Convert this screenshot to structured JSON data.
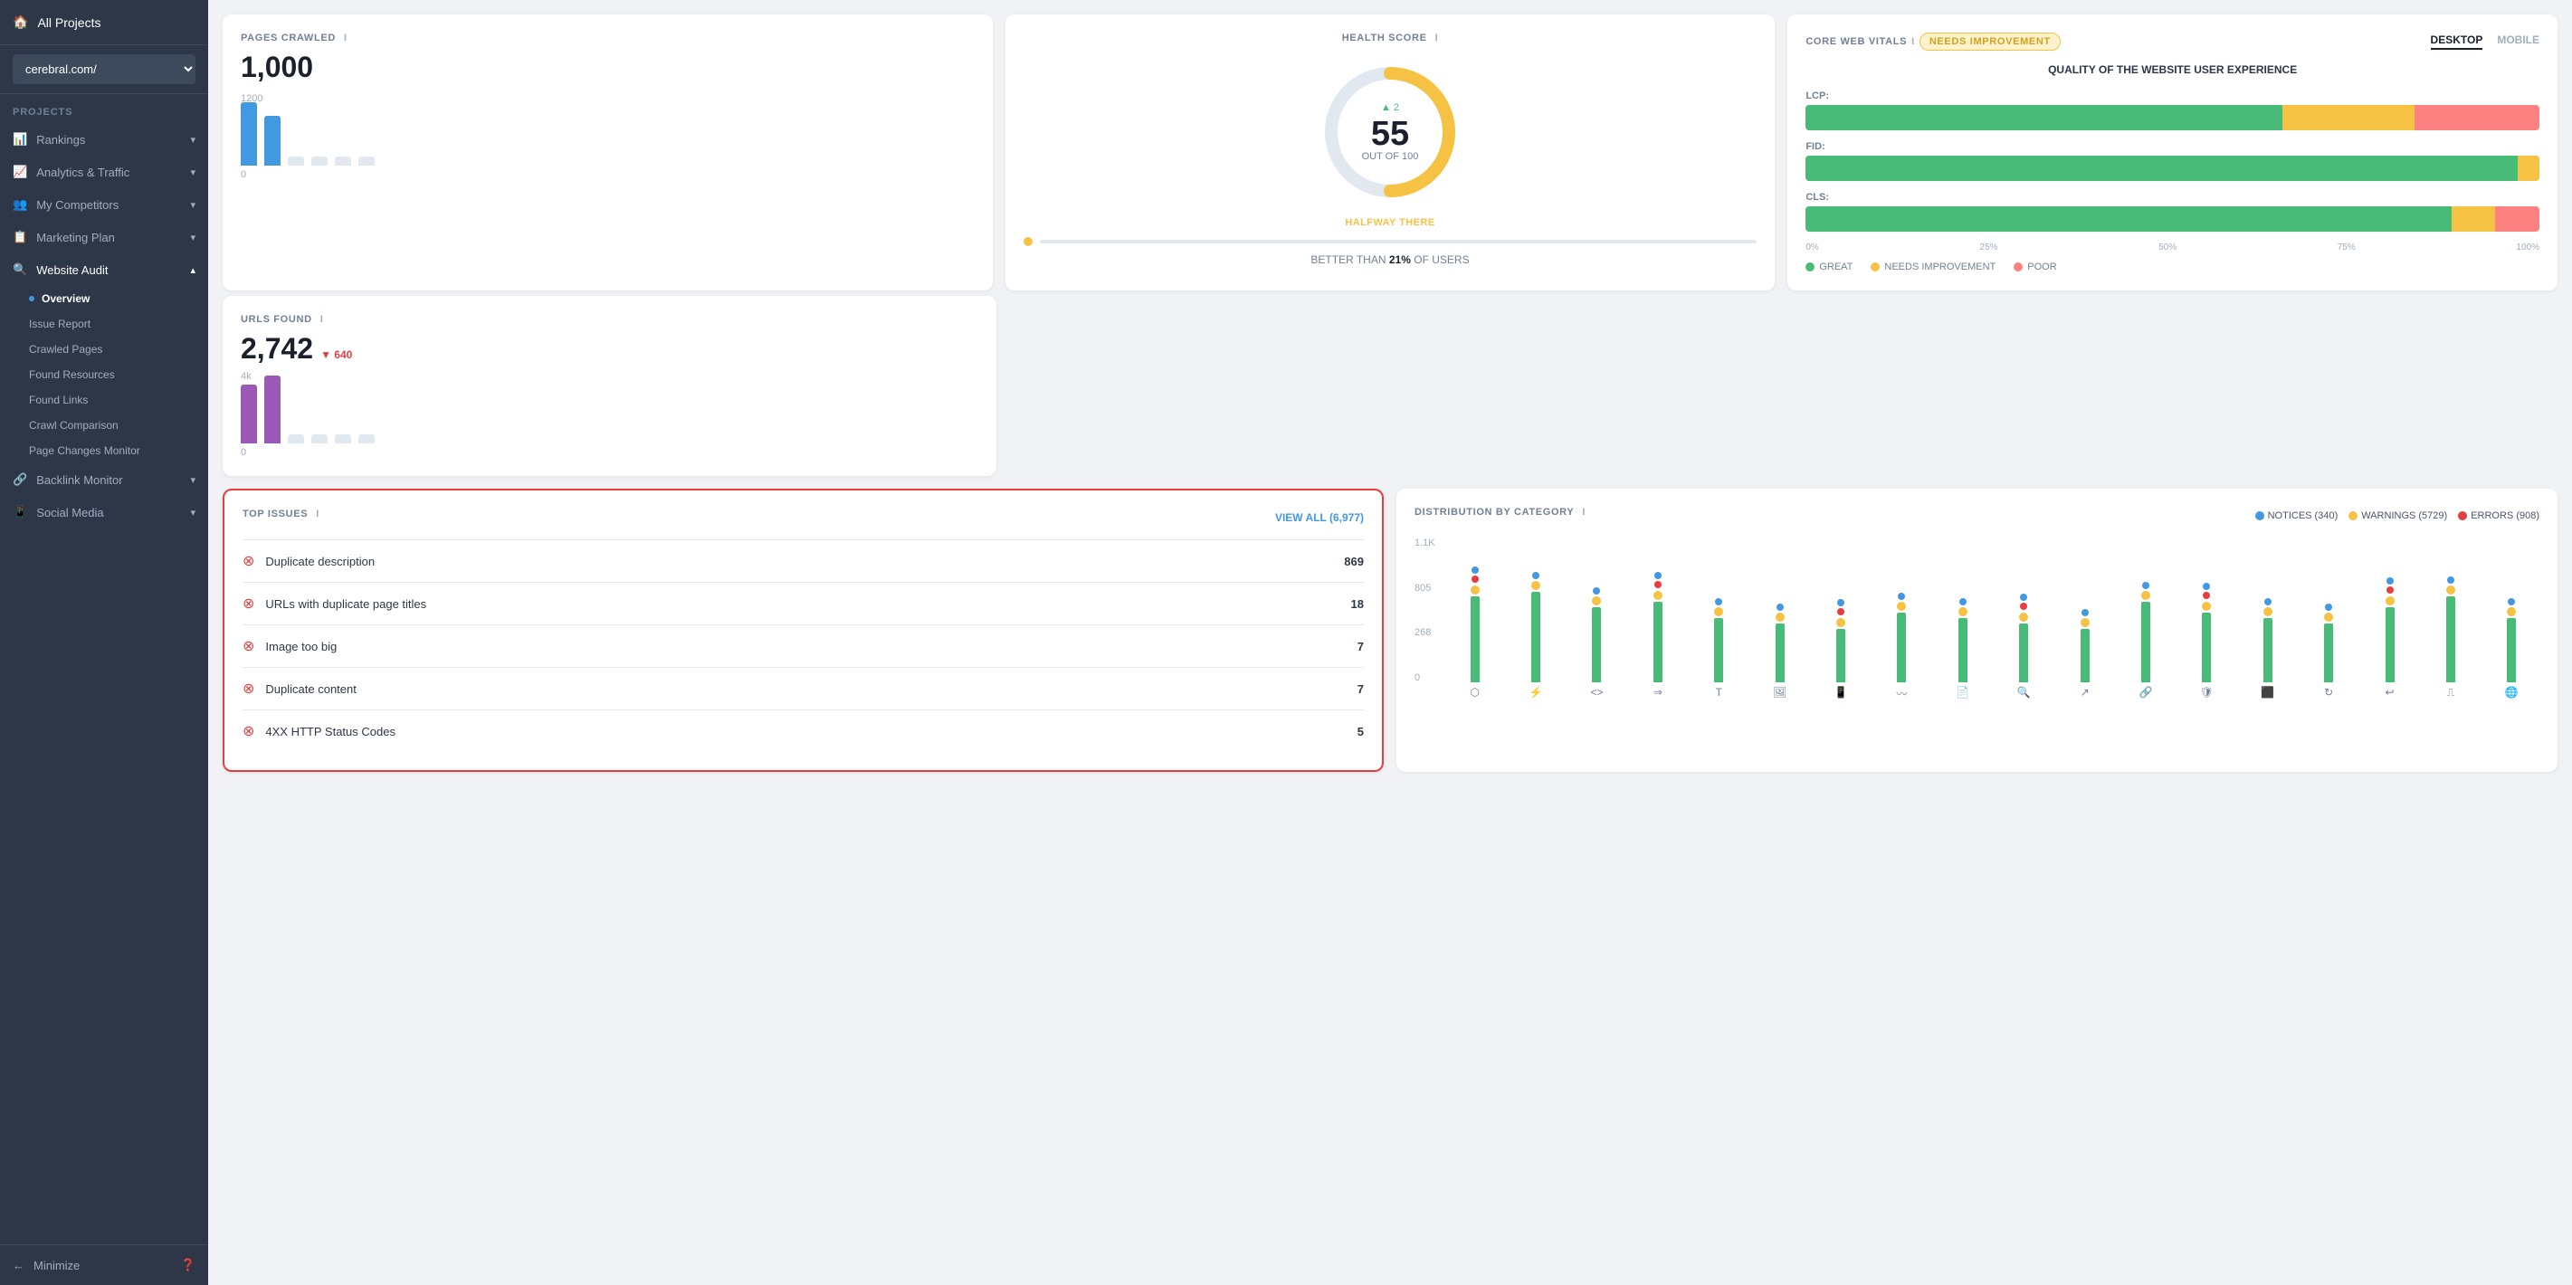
{
  "sidebar": {
    "all_projects_label": "All Projects",
    "project_name": "cerebral.com/",
    "projects_section": "PROJECTS",
    "items": [
      {
        "id": "rankings",
        "label": "Rankings",
        "icon": "📊",
        "has_chevron": true
      },
      {
        "id": "analytics",
        "label": "Analytics & Traffic",
        "icon": "📈",
        "has_chevron": true
      },
      {
        "id": "competitors",
        "label": "My Competitors",
        "icon": "👥",
        "has_chevron": true
      },
      {
        "id": "marketing",
        "label": "Marketing Plan",
        "icon": "📋",
        "has_chevron": true
      },
      {
        "id": "audit",
        "label": "Website Audit",
        "icon": "🔍",
        "has_chevron": true,
        "active": true
      }
    ],
    "audit_sub_items": [
      {
        "id": "overview",
        "label": "Overview",
        "active": true
      },
      {
        "id": "issue-report",
        "label": "Issue Report"
      },
      {
        "id": "crawled-pages",
        "label": "Crawled Pages"
      },
      {
        "id": "found-resources",
        "label": "Found Resources"
      },
      {
        "id": "found-links",
        "label": "Found Links"
      },
      {
        "id": "crawl-comparison",
        "label": "Crawl Comparison"
      },
      {
        "id": "page-changes",
        "label": "Page Changes Monitor"
      }
    ],
    "other_items": [
      {
        "id": "backlink",
        "label": "Backlink Monitor",
        "icon": "🔗",
        "has_chevron": true
      },
      {
        "id": "social",
        "label": "Social Media",
        "icon": "📱",
        "has_chevron": true
      }
    ],
    "minimize_label": "Minimize",
    "help_icon": "?"
  },
  "pages_crawled": {
    "label": "PAGES CRAWLED",
    "info": "i",
    "value": "1,000",
    "chart_max": "1200",
    "chart_min": "0",
    "bars": [
      {
        "height": 70,
        "color": "#4299e1"
      },
      {
        "height": 55,
        "color": "#4299e1"
      },
      {
        "height": 10,
        "color": "#e2e8f0"
      },
      {
        "height": 10,
        "color": "#e2e8f0"
      },
      {
        "height": 10,
        "color": "#e2e8f0"
      },
      {
        "height": 10,
        "color": "#e2e8f0"
      }
    ]
  },
  "urls_found": {
    "label": "URLS FOUND",
    "info": "i",
    "value": "2,742",
    "delta": "▼ 640",
    "chart_max": "4k",
    "chart_min": "0",
    "bars": [
      {
        "height": 65,
        "color": "#9b59b6"
      },
      {
        "height": 75,
        "color": "#9b59b6"
      },
      {
        "height": 10,
        "color": "#e2e8f0"
      },
      {
        "height": 10,
        "color": "#e2e8f0"
      },
      {
        "height": 10,
        "color": "#e2e8f0"
      },
      {
        "height": 10,
        "color": "#e2e8f0"
      }
    ]
  },
  "health_score": {
    "label": "HEALTH SCORE",
    "info": "i",
    "score": "55",
    "out_of": "OUT OF 100",
    "delta": "▲ 2",
    "halfway_label": "HALFWAY THERE",
    "better_than_prefix": "BETTER THAN",
    "better_than_pct": "21%",
    "better_than_suffix": "OF USERS"
  },
  "cwv": {
    "title": "CORE WEB VITALS",
    "info": "i",
    "badge": "Needs improvement",
    "tabs": [
      "DESKTOP",
      "MOBILE"
    ],
    "active_tab": "DESKTOP",
    "subtitle": "QUALITY OF THE WEBSITE USER EXPERIENCE",
    "bars": [
      {
        "label": "LCP:",
        "segments": [
          {
            "pct": 65,
            "color": "#48bb78"
          },
          {
            "pct": 18,
            "color": "#f6c244"
          },
          {
            "pct": 17,
            "color": "#fc8181"
          }
        ]
      },
      {
        "label": "FID:",
        "segments": [
          {
            "pct": 97,
            "color": "#48bb78"
          },
          {
            "pct": 3,
            "color": "#f6c244"
          }
        ]
      },
      {
        "label": "CLS:",
        "segments": [
          {
            "pct": 88,
            "color": "#48bb78"
          },
          {
            "pct": 6,
            "color": "#f6c244"
          },
          {
            "pct": 6,
            "color": "#fc8181"
          }
        ]
      }
    ],
    "axis_labels": [
      "0%",
      "25%",
      "50%",
      "75%",
      "100%"
    ],
    "legend": [
      {
        "label": "GREAT",
        "color": "#48bb78"
      },
      {
        "label": "NEEDS IMPROVEMENT",
        "color": "#f6c244"
      },
      {
        "label": "POOR",
        "color": "#fc8181"
      }
    ]
  },
  "top_issues": {
    "label": "TOP ISSUES",
    "info": "i",
    "view_all": "VIEW ALL (6,977)",
    "issues": [
      {
        "name": "Duplicate description",
        "count": "869"
      },
      {
        "name": "URLs with duplicate page titles",
        "count": "18"
      },
      {
        "name": "Image too big",
        "count": "7"
      },
      {
        "name": "Duplicate content",
        "count": "7"
      },
      {
        "name": "4XX HTTP Status Codes",
        "count": "5"
      }
    ]
  },
  "distribution": {
    "label": "DISTRIBUTION BY CATEGORY",
    "info": "i",
    "legend": [
      {
        "label": "NOTICES (340)",
        "color": "#4299e1"
      },
      {
        "label": "WARNINGS (5729)",
        "color": "#f6c244"
      },
      {
        "label": "ERRORS (908)",
        "color": "#e53e3e"
      }
    ],
    "y_axis": [
      "1.1K",
      "805",
      "268",
      "0"
    ],
    "cols": [
      {
        "notice": 5,
        "warning": 80,
        "error": 15,
        "icon": "⬡"
      },
      {
        "notice": 5,
        "warning": 85,
        "error": 5,
        "icon": "⚡"
      },
      {
        "notice": 5,
        "warning": 70,
        "error": 10,
        "icon": "<>"
      },
      {
        "notice": 5,
        "warning": 75,
        "error": 8,
        "icon": "⇒"
      },
      {
        "notice": 5,
        "warning": 60,
        "error": 5,
        "icon": "T"
      },
      {
        "notice": 5,
        "warning": 55,
        "error": 20,
        "icon": "🖼"
      },
      {
        "notice": 5,
        "warning": 50,
        "error": 8,
        "icon": "📱"
      },
      {
        "notice": 20,
        "warning": 65,
        "error": 5,
        "icon": "〰"
      },
      {
        "notice": 5,
        "warning": 60,
        "error": 10,
        "icon": "📄"
      },
      {
        "notice": 5,
        "warning": 55,
        "error": 5,
        "icon": "🔍"
      },
      {
        "notice": 5,
        "warning": 50,
        "error": 5,
        "icon": "↗"
      },
      {
        "notice": 5,
        "warning": 75,
        "error": 10,
        "icon": "🔗"
      },
      {
        "notice": 5,
        "warning": 65,
        "error": 5,
        "icon": "🛡"
      },
      {
        "notice": 5,
        "warning": 60,
        "error": 8,
        "icon": "⬛"
      },
      {
        "notice": 5,
        "warning": 55,
        "error": 5,
        "icon": "↻"
      },
      {
        "notice": 5,
        "warning": 70,
        "error": 5,
        "icon": "↩"
      },
      {
        "notice": 5,
        "warning": 80,
        "error": 90,
        "icon": "⎍"
      },
      {
        "notice": 5,
        "warning": 60,
        "error": 5,
        "icon": "🌐"
      }
    ]
  }
}
